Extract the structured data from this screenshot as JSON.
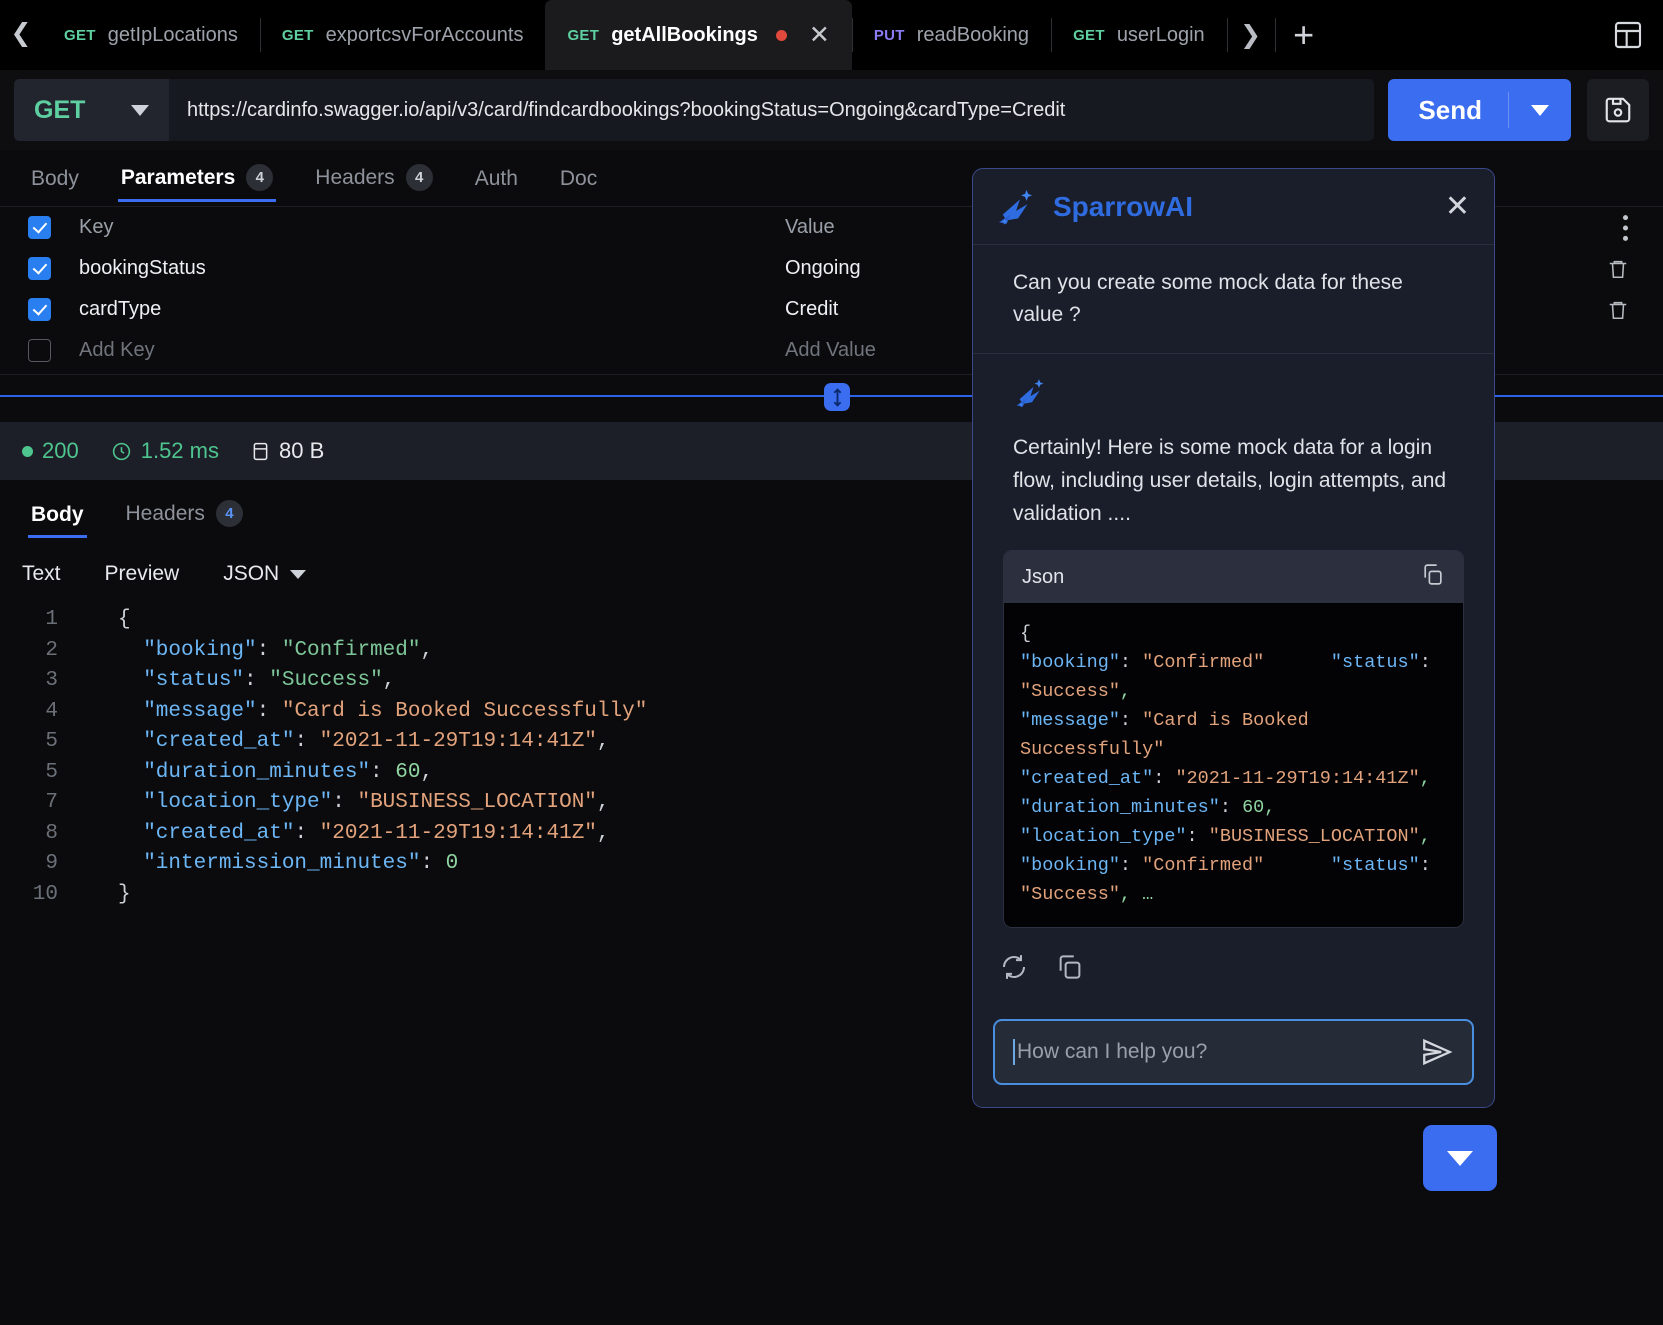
{
  "tabbar": {
    "nav_left_icon": "chevron-left-icon",
    "nav_right_icon": "chevron-right-icon",
    "add_icon": "plus-icon",
    "layout_icon": "panel-layout-icon",
    "tabs": [
      {
        "method": "GET",
        "name": "getIpLocations",
        "active": false,
        "unsaved": false
      },
      {
        "method": "GET",
        "name": "exportcsvForAccounts",
        "active": false,
        "unsaved": false
      },
      {
        "method": "GET",
        "name": "getAllBookings",
        "active": true,
        "unsaved": true
      },
      {
        "method": "PUT",
        "name": "readBooking",
        "active": false,
        "unsaved": false
      },
      {
        "method": "GET",
        "name": "userLogin",
        "active": false,
        "unsaved": false
      }
    ]
  },
  "urlbar": {
    "method": "GET",
    "url": "https://cardinfo.swagger.io/api/v3/card/findcardbookings?bookingStatus=Ongoing&cardType=Credit",
    "send_label": "Send",
    "save_icon": "save-disk-icon",
    "dropdown_icon": "chevron-down-icon"
  },
  "request_tabs": [
    {
      "label": "Body",
      "badge": "",
      "active": false
    },
    {
      "label": "Parameters",
      "badge": "4",
      "active": true
    },
    {
      "label": "Headers",
      "badge": "4",
      "active": false
    },
    {
      "label": "Auth",
      "badge": "",
      "active": false
    },
    {
      "label": "Doc",
      "badge": "",
      "active": false
    }
  ],
  "parameters": {
    "header": {
      "key": "Key",
      "value": "Value"
    },
    "rows": [
      {
        "checked": true,
        "key": "bookingStatus",
        "value": "Ongoing"
      },
      {
        "checked": true,
        "key": "cardType",
        "value": "Credit"
      }
    ],
    "add_row": {
      "key_placeholder": "Add Key",
      "value_placeholder": "Add Value"
    },
    "delete_icon": "trash-icon",
    "more_icon": "more-vertical-icon"
  },
  "response_status": {
    "code": "200",
    "time": "1.52 ms",
    "size": "80 B",
    "clock_icon": "clock-icon",
    "size_icon": "database-icon"
  },
  "response_tabs": [
    {
      "label": "Body",
      "badge": "",
      "active": true
    },
    {
      "label": "Headers",
      "badge": "4",
      "active": false
    }
  ],
  "viewer_tabs": [
    {
      "label": "Text"
    },
    {
      "label": "Preview"
    },
    {
      "label": "JSON",
      "has_caret": true
    }
  ],
  "response_body": {
    "lines": [
      {
        "num": "1",
        "tokens": [
          {
            "t": "{",
            "c": "p"
          }
        ]
      },
      {
        "num": "2",
        "tokens": [
          {
            "t": "  \"booking\"",
            "c": "k"
          },
          {
            "t": ": ",
            "c": "p"
          },
          {
            "t": "\"Confirmed\"",
            "c": "s"
          },
          {
            "t": ",",
            "c": "p"
          }
        ]
      },
      {
        "num": "3",
        "tokens": [
          {
            "t": "  \"status\"",
            "c": "k"
          },
          {
            "t": ": ",
            "c": "p"
          },
          {
            "t": "\"Success\"",
            "c": "s"
          },
          {
            "t": ",",
            "c": "p"
          }
        ]
      },
      {
        "num": "4",
        "tokens": [
          {
            "t": "  \"message\"",
            "c": "k"
          },
          {
            "t": ": ",
            "c": "p"
          },
          {
            "t": "\"Card is Booked Successfully\"",
            "c": "s2"
          }
        ]
      },
      {
        "num": "5",
        "tokens": [
          {
            "t": "  \"created_at\"",
            "c": "k"
          },
          {
            "t": ": ",
            "c": "p"
          },
          {
            "t": "\"2021-11-29T19:14:41Z\"",
            "c": "s2"
          },
          {
            "t": ",",
            "c": "p"
          }
        ]
      },
      {
        "num": "5",
        "tokens": [
          {
            "t": "  \"duration_minutes\"",
            "c": "k"
          },
          {
            "t": ": ",
            "c": "p"
          },
          {
            "t": "60",
            "c": "n"
          },
          {
            "t": ",",
            "c": "p"
          }
        ]
      },
      {
        "num": "7",
        "tokens": [
          {
            "t": "  \"location_type\"",
            "c": "k"
          },
          {
            "t": ": ",
            "c": "p"
          },
          {
            "t": "\"BUSINESS_LOCATION\"",
            "c": "s2"
          },
          {
            "t": ",",
            "c": "p"
          }
        ]
      },
      {
        "num": "8",
        "tokens": [
          {
            "t": "  \"created_at\"",
            "c": "k"
          },
          {
            "t": ": ",
            "c": "p"
          },
          {
            "t": "\"2021-11-29T19:14:41Z\"",
            "c": "s2"
          },
          {
            "t": ",",
            "c": "p"
          }
        ]
      },
      {
        "num": "9",
        "tokens": [
          {
            "t": "  \"intermission_minutes\"",
            "c": "k"
          },
          {
            "t": ": ",
            "c": "p"
          },
          {
            "t": "0",
            "c": "n"
          }
        ]
      },
      {
        "num": "10",
        "tokens": [
          {
            "t": "}",
            "c": "p"
          }
        ]
      }
    ]
  },
  "sparrow_ai": {
    "title": "SparrowAI",
    "logo_icon": "sparrow-bird-icon",
    "close_icon": "close-icon",
    "user_message": "Can you create some mock data for these value ?",
    "reply_text": "Certainly! Here is some mock data for a login flow, including user details, login attempts, and validation ....",
    "code_block": {
      "language_label": "Json",
      "copy_icon": "copy-icon",
      "tokens": [
        {
          "t": "{\n",
          "c": "p"
        },
        {
          "t": "\"booking\"",
          "c": "k"
        },
        {
          "t": ": ",
          "c": "p"
        },
        {
          "t": "\"Confirmed\"",
          "c": "s2"
        },
        {
          "t": "      ",
          "c": "p"
        },
        {
          "t": "\"status\"",
          "c": "k"
        },
        {
          "t": ": ",
          "c": "p"
        },
        {
          "t": "\"Success\"",
          "c": "s2"
        },
        {
          "t": ",\n",
          "c": "n"
        },
        {
          "t": "\"message\"",
          "c": "k"
        },
        {
          "t": ": ",
          "c": "p"
        },
        {
          "t": "\"Card is Booked Successfully\"\n",
          "c": "s2"
        },
        {
          "t": "\"created_at\"",
          "c": "k"
        },
        {
          "t": ": ",
          "c": "p"
        },
        {
          "t": "\"2021-11-29T19:14:41Z\"",
          "c": "s2"
        },
        {
          "t": ",\n",
          "c": "n"
        },
        {
          "t": "\"duration_minutes\"",
          "c": "k"
        },
        {
          "t": ": ",
          "c": "p"
        },
        {
          "t": "60",
          "c": "n"
        },
        {
          "t": ",\n",
          "c": "n"
        },
        {
          "t": "\"location_type\"",
          "c": "k"
        },
        {
          "t": ": ",
          "c": "p"
        },
        {
          "t": "\"BUSINESS_LOCATION\"",
          "c": "s2"
        },
        {
          "t": ",\n",
          "c": "n"
        },
        {
          "t": "\"booking\"",
          "c": "k"
        },
        {
          "t": ": ",
          "c": "p"
        },
        {
          "t": "\"Confirmed\"",
          "c": "s2"
        },
        {
          "t": "      ",
          "c": "p"
        },
        {
          "t": "\"status\"",
          "c": "k"
        },
        {
          "t": ": ",
          "c": "p"
        },
        {
          "t": "\"Success\"",
          "c": "s2"
        },
        {
          "t": ",",
          "c": "n"
        },
        {
          "t": " …",
          "c": "n"
        }
      ]
    },
    "actions": [
      {
        "icon": "regenerate-icon",
        "name": "regenerate-button"
      },
      {
        "icon": "copy-icon",
        "name": "copy-response-button"
      }
    ],
    "input": {
      "placeholder": "How can I help you?",
      "value": "",
      "send_icon": "send-plane-icon"
    }
  },
  "fab": {
    "icon": "chevron-down-icon"
  }
}
